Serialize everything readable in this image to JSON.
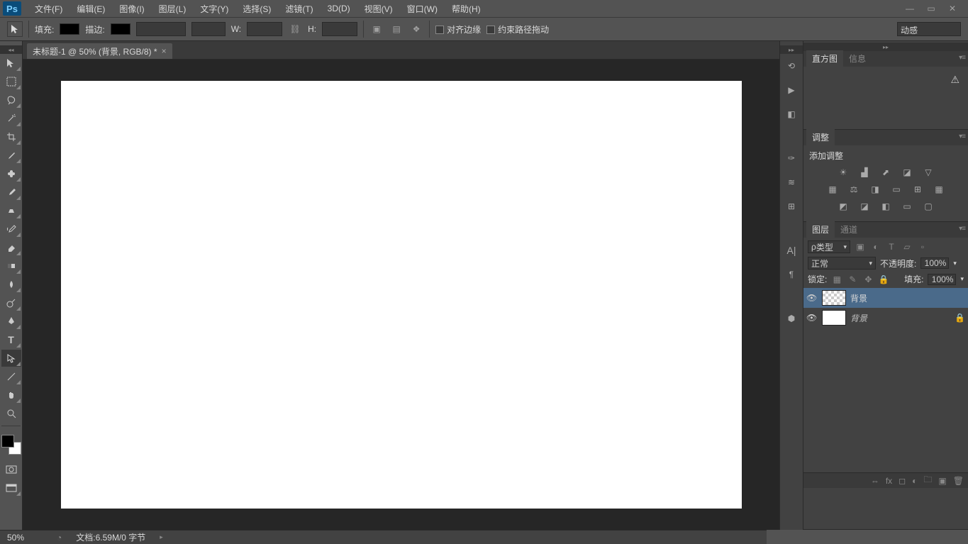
{
  "app": {
    "logo": "Ps"
  },
  "menu": {
    "items": [
      "文件(F)",
      "编辑(E)",
      "图像(I)",
      "图层(L)",
      "文字(Y)",
      "选择(S)",
      "滤镜(T)",
      "3D(D)",
      "视图(V)",
      "窗口(W)",
      "帮助(H)"
    ]
  },
  "options": {
    "fill_label": "填充:",
    "stroke_label": "描边:",
    "w_label": "W:",
    "h_label": "H:",
    "align_edges": "对齐边缘",
    "constrain_path": "约束路径拖动",
    "right_mode": "动感"
  },
  "document": {
    "tab_title": "未标题-1 @ 50% (背景, RGB/8) *"
  },
  "panels": {
    "histogram": {
      "tab1": "直方图",
      "tab2": "信息"
    },
    "adjustments": {
      "tab": "调整",
      "label": "添加调整"
    },
    "layers": {
      "tab1": "图层",
      "tab2": "通道",
      "kind_label": "类型",
      "blend_mode": "正常",
      "opacity_label": "不透明度:",
      "opacity_value": "100%",
      "lock_label": "锁定:",
      "fill_label": "填充:",
      "fill_value": "100%",
      "layer1_name": "背景",
      "layer2_name": "背景"
    }
  },
  "status": {
    "zoom": "50%",
    "doc_info": "文档:6.59M/0 字节"
  }
}
